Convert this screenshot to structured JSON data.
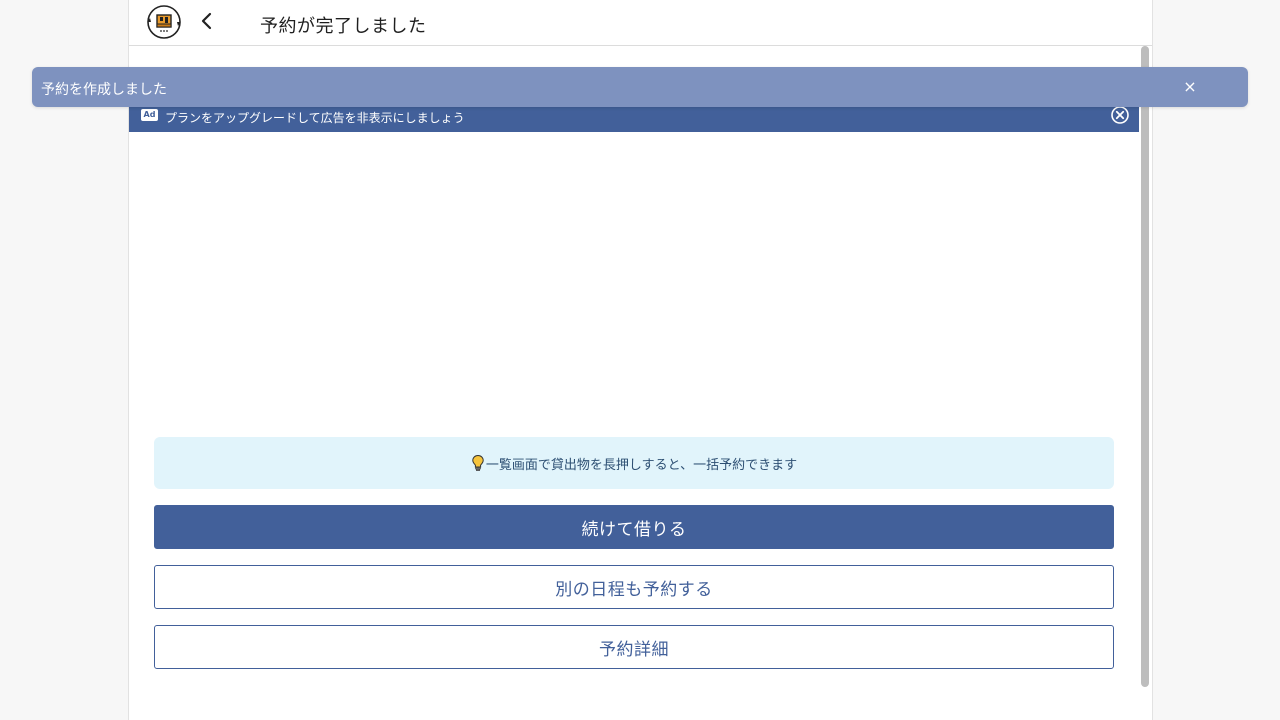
{
  "header": {
    "title": "予約が完了しました",
    "logo_icon": "app-logo-icon",
    "back_icon": "chevron-left-icon"
  },
  "toast": {
    "message": "予約を作成しました",
    "close_label": "×",
    "background": "#7e92bf"
  },
  "ad": {
    "badge": "Ad",
    "text": "プランをアップグレードして広告を非表示にしましょう",
    "close_icon": "close-circle-icon",
    "background": "#42609a"
  },
  "tip": {
    "icon": "lightbulb-icon",
    "text": "一覧画面で貸出物を長押しすると、一括予約できます",
    "background": "#e1f4fb"
  },
  "actions": {
    "continue_label": "続けて借りる",
    "other_date_label": "別の日程も予約する",
    "details_label": "予約詳細"
  },
  "colors": {
    "primary": "#42609a"
  }
}
